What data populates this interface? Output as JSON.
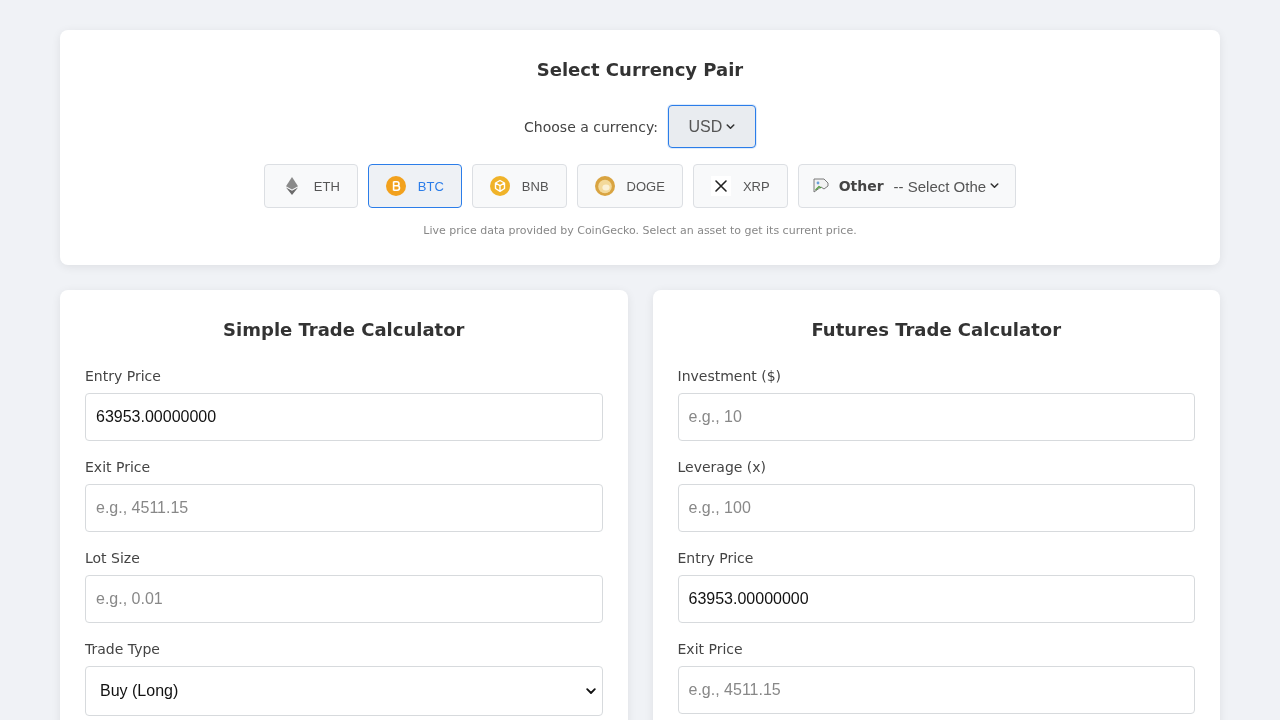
{
  "pair_selector": {
    "title": "Select Currency Pair",
    "currency_label": "Choose a currency:",
    "currency": {
      "value": "USD",
      "focused": true
    },
    "assets": [
      {
        "kind": "eth",
        "label": "ETH",
        "selected": false
      },
      {
        "kind": "btc",
        "label": "BTC",
        "selected": true
      },
      {
        "kind": "bnb",
        "label": "BNB",
        "selected": false
      },
      {
        "kind": "doge",
        "label": "DOGE",
        "selected": false
      },
      {
        "kind": "xrp",
        "label": "XRP",
        "selected": false
      }
    ],
    "other": {
      "label": "Other",
      "select_text": "-- Select Othe"
    },
    "note": "Live price data provided by CoinGecko. Select an asset to get its current price."
  },
  "calculators": [
    {
      "title": "Simple Trade Calculator",
      "fields": [
        {
          "kind": "input",
          "label": "Entry Price",
          "value": "63953.00000000"
        },
        {
          "kind": "input",
          "label": "Exit Price",
          "placeholder": "e.g., 4511.15"
        },
        {
          "kind": "input",
          "label": "Lot Size",
          "placeholder": "e.g., 0.01"
        },
        {
          "kind": "select",
          "label": "Trade Type",
          "value": "Buy (Long)"
        }
      ]
    },
    {
      "title": "Futures Trade Calculator",
      "fields": [
        {
          "kind": "input",
          "label": "Investment ($)",
          "placeholder": "e.g., 10"
        },
        {
          "kind": "input",
          "label": "Leverage (x)",
          "placeholder": "e.g., 100"
        },
        {
          "kind": "input",
          "label": "Entry Price",
          "value": "63953.00000000"
        },
        {
          "kind": "input",
          "label": "Exit Price",
          "placeholder": "e.g., 4511.15"
        }
      ]
    }
  ]
}
